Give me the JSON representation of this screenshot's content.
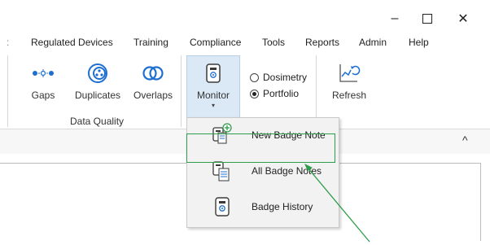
{
  "window": {
    "minimize_glyph": "–",
    "maximize_glyph": "☐",
    "close_glyph": "✕"
  },
  "menu": {
    "leading_sep": ":",
    "items": [
      "Regulated Devices",
      "Training",
      "Compliance",
      "Tools",
      "Reports",
      "Admin",
      "Help"
    ]
  },
  "ribbon": {
    "gaps": "Gaps",
    "duplicates": "Duplicates",
    "overlaps": "Overlaps",
    "group_data_quality": "Data Quality",
    "monitor": "Monitor",
    "monitor_caret": "▾",
    "radio_dosimetry": "Dosimetry",
    "radio_portfolio": "Portfolio",
    "radio_selected": "Portfolio",
    "refresh": "Refresh",
    "collapse_glyph": "^"
  },
  "dropdown": {
    "items": [
      "New Badge Note",
      "All Badge Notes",
      "Badge History"
    ]
  },
  "colors": {
    "accent_blue": "#1f6fd1",
    "highlight_green": "#2e9d4a",
    "monitor_bg": "#dbe9f7"
  }
}
